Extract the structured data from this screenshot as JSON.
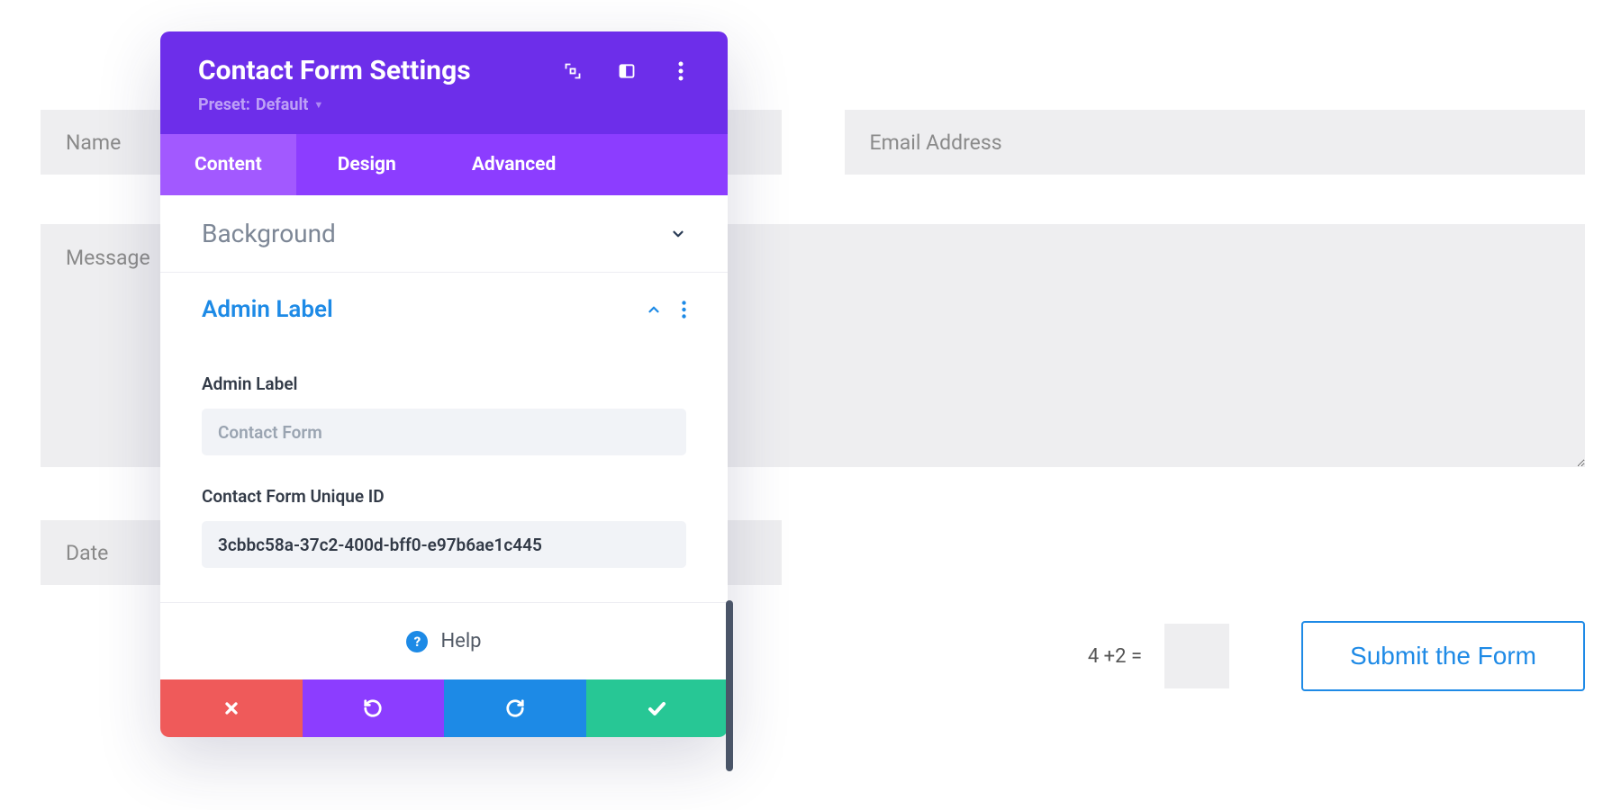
{
  "form": {
    "name_placeholder": "Name",
    "email_placeholder": "Email Address",
    "message_placeholder": "Message",
    "date_placeholder": "Date",
    "captcha_label": "4 +2 =",
    "submit_label": "Submit the Form"
  },
  "modal": {
    "title": "Contact Form Settings",
    "preset_prefix": "Preset: ",
    "preset_value": "Default",
    "tabs": {
      "content": "Content",
      "design": "Design",
      "advanced": "Advanced"
    },
    "sections": {
      "background_title": "Background",
      "admin_label_title": "Admin Label"
    },
    "admin_label": {
      "field_label": "Admin Label",
      "field_placeholder": "Contact Form",
      "field_value": "",
      "unique_id_label": "Contact Form Unique ID",
      "unique_id_value": "3cbbc58a-37c2-400d-bff0-e97b6ae1c445"
    },
    "help_label": "Help"
  }
}
